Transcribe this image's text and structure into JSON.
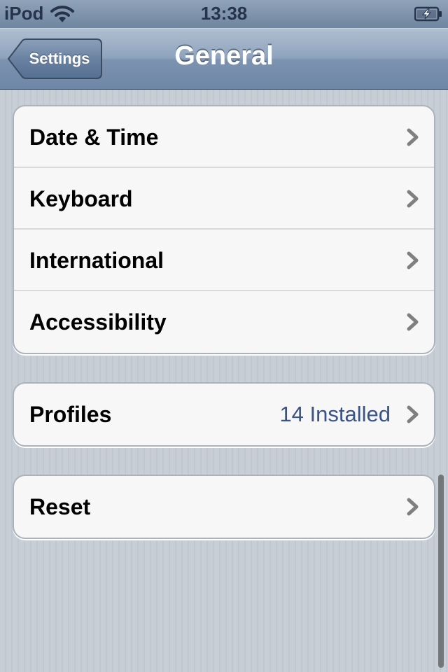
{
  "status_bar": {
    "carrier": "iPod",
    "time": "13:38",
    "wifi_icon": "wifi-icon",
    "battery_icon": "battery-charging-icon"
  },
  "nav_bar": {
    "title": "General",
    "back_label": "Settings"
  },
  "groups": [
    {
      "cells": [
        {
          "label": "Date & Time",
          "icon": "chevron-right-icon"
        },
        {
          "label": "Keyboard",
          "icon": "chevron-right-icon"
        },
        {
          "label": "International",
          "icon": "chevron-right-icon"
        },
        {
          "label": "Accessibility",
          "icon": "chevron-right-icon"
        }
      ]
    },
    {
      "cells": [
        {
          "label": "Profiles",
          "detail": "14 Installed",
          "icon": "chevron-right-icon"
        }
      ]
    },
    {
      "cells": [
        {
          "label": "Reset",
          "icon": "chevron-right-icon"
        }
      ]
    }
  ],
  "colors": {
    "detail_text": "#385487",
    "nav_bar": "#7c93b0",
    "background": "#c5ccd4"
  }
}
